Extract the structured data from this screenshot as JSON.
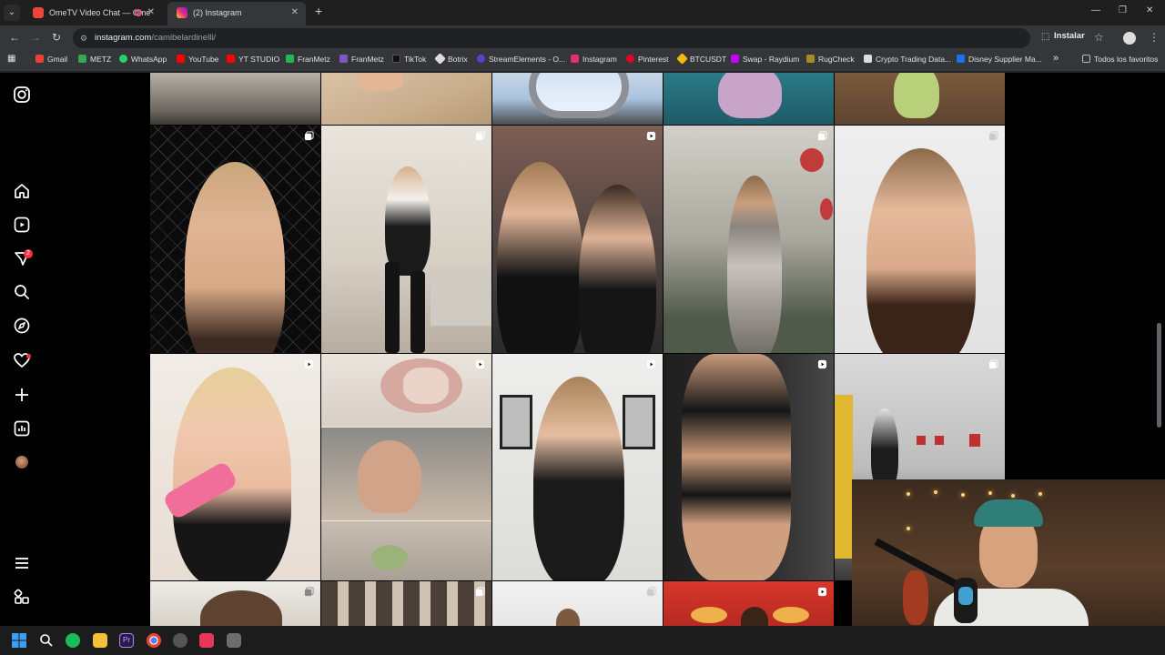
{
  "browser": {
    "tabs": [
      {
        "title": "OmeTV Video Chat — Ome",
        "active": false,
        "recording": true
      },
      {
        "title": "(2) Instagram",
        "active": true
      }
    ],
    "url_host": "instagram.com",
    "url_path": "/camibelardinelli/",
    "install_label": "Instalar",
    "bookmarks": [
      {
        "label": "Gmail",
        "color": "#ea4335"
      },
      {
        "label": "METZ",
        "color": "#34a853"
      },
      {
        "label": "WhatsApp",
        "color": "#25d366"
      },
      {
        "label": "YouTube",
        "color": "#ff0000"
      },
      {
        "label": "YT STUDIO",
        "color": "#ff0000"
      },
      {
        "label": "FranMetz",
        "color": "#1db954"
      },
      {
        "label": "FranMetz",
        "color": "#7e57c2"
      },
      {
        "label": "TikTok",
        "color": "#000000"
      },
      {
        "label": "Botrix",
        "color": "#dddddd"
      },
      {
        "label": "StreamElements - O...",
        "color": "#5b3fd1"
      },
      {
        "label": "Instagram",
        "color": "#e1306c"
      },
      {
        "label": "Pinterest",
        "color": "#e60023"
      },
      {
        "label": "BTCUSDT",
        "color": "#f0b90b"
      },
      {
        "label": "Swap - Raydium",
        "color": "#c200fb"
      },
      {
        "label": "RugCheck",
        "color": "#a38b2a"
      },
      {
        "label": "Crypto Trading Data...",
        "color": "#dddddd"
      },
      {
        "label": "Disney Supplier Ma...",
        "color": "#1a73e8"
      }
    ],
    "all_favorites_label": "Todos los favoritos"
  },
  "sidebar": {
    "notification_badge": "2",
    "items": [
      "instagram-logo-icon",
      "home-icon",
      "reels-icon",
      "messages-icon",
      "search-icon",
      "explore-icon",
      "notifications-icon",
      "create-icon",
      "dashboard-icon",
      "profile-avatar",
      "more-menu-icon",
      "also-from-meta-icon"
    ]
  },
  "posts": [
    {
      "kind": "carousel"
    },
    {
      "kind": "carousel"
    },
    {
      "kind": "reel"
    },
    {
      "kind": "carousel"
    },
    {
      "kind": "carousel"
    },
    {
      "kind": "reel"
    },
    {
      "kind": "reel"
    },
    {
      "kind": "reel"
    },
    {
      "kind": "reel"
    },
    {
      "kind": "carousel"
    },
    {
      "kind": "reel"
    },
    {
      "kind": "carousel"
    },
    {
      "kind": "carousel"
    },
    {
      "kind": "reel"
    }
  ],
  "colors": {
    "background": "#000000",
    "notification_red": "#ff3040",
    "chrome_dark": "#202124"
  }
}
